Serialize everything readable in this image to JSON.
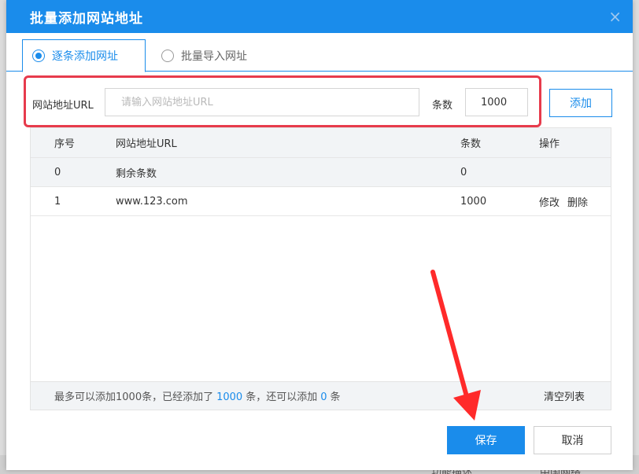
{
  "dialog": {
    "title": "批量添加网站地址",
    "close_icon": "close-icon",
    "tabs": [
      {
        "label": "逐条添加网址",
        "selected": true
      },
      {
        "label": "批量导入网址",
        "selected": false
      }
    ]
  },
  "form": {
    "url_label": "网站地址URL",
    "url_placeholder": "请输入网站地址URL",
    "url_value": "",
    "count_label": "条数",
    "count_value": "1000",
    "add_label": "添加"
  },
  "table": {
    "columns": [
      "序号",
      "网站地址URL",
      "条数",
      "操作"
    ],
    "rows": [
      {
        "index": "0",
        "url": "剩余条数",
        "count": "0",
        "actions": []
      },
      {
        "index": "1",
        "url": "www.123.com",
        "count": "1000",
        "actions": [
          "修改",
          "删除"
        ]
      }
    ]
  },
  "footer": {
    "prefix": "最多可以添加1000条，已经添加了",
    "added_count": "1000",
    "middle": "条，还可以添加",
    "remaining_count": "0",
    "suffix": "条",
    "clear_label": "清空列表"
  },
  "buttons": {
    "save_label": "保存",
    "cancel_label": "取消"
  },
  "background": {
    "partial_text_left": "功能描述",
    "partial_text_right": "中国网络"
  },
  "colors": {
    "primary": "#1a8ceb",
    "highlight_border": "#e73b4c",
    "arrow": "#ff2a2a"
  }
}
